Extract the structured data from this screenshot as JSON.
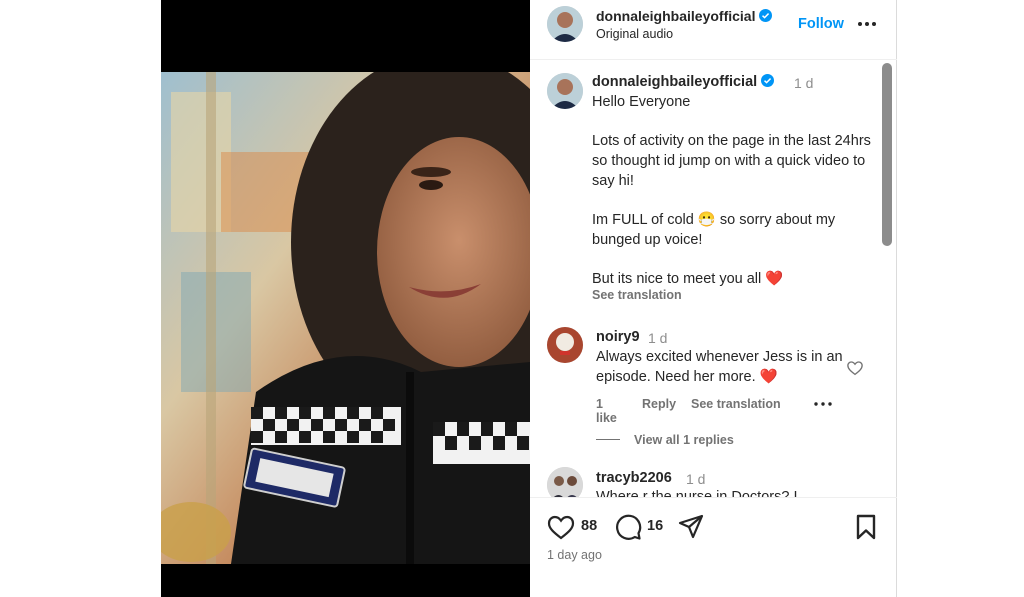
{
  "post": {
    "username": "donnaleighbaileyofficial",
    "audio": "Original audio",
    "follow_label": "Follow"
  },
  "caption": {
    "username": "donnaleighbaileyofficial",
    "time": "1 d",
    "text": "Hello Everyone\n\nLots of activity on the page in the last 24hrs so thought id jump on with a quick video to say hi!\n\nIm FULL of cold 😷 so sorry about my bunged up voice!\n\nBut its nice to meet you all ❤️",
    "see_translation": "See translation"
  },
  "comments": [
    {
      "username": "noiry9",
      "time": "1 d",
      "text": "Always excited whenever Jess is in an episode. Need her more. ❤️",
      "likes": "1 like",
      "reply": "Reply",
      "see_translation": "See translation",
      "view_replies": "View all 1 replies"
    },
    {
      "username": "tracyb2206",
      "time": "1 d",
      "text": "Where r the nurse in Doctors? I"
    }
  ],
  "actions": {
    "like_count": "88",
    "comment_count": "16",
    "time_ago": "1 day ago"
  },
  "colors": {
    "accent": "#0095f6",
    "verified": "#0095f6",
    "heart": "#e0245e"
  },
  "icons": [
    "verified-badge-icon",
    "more-icon",
    "heart-icon",
    "comment-icon",
    "share-icon",
    "bookmark-icon"
  ]
}
